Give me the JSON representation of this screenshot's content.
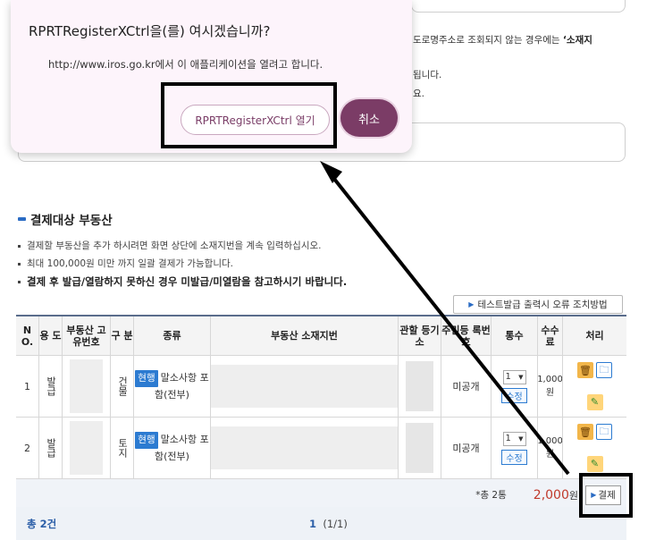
{
  "background": {
    "notice_line1_plain": "도로명주소로 조회되지 않는 경우에는 ",
    "notice_line1_bold": "‘소재지",
    "notice_line2": "됩니다.",
    "notice_line3": "요."
  },
  "section": {
    "title": "결제대상 부동산",
    "notes": [
      "결제할 부동산을 추가 하시려면 화면 상단에 소재지번을 계속 입력하십시오.",
      "최대 100,000원 미만 까지 일괄 결제가 가능합니다.",
      "결제 후 발급/열람하지 못하신 경우 미발급/미열람을 참고하시기 바랍니다."
    ],
    "guide_button": "테스트발급 출력시 오류 조치방법"
  },
  "table": {
    "headers": [
      "N O.",
      "용 도",
      "부동산 고유번호",
      "구 분",
      "종류",
      "부동산 소재지번",
      "관할 등기소",
      "주민등 록번호",
      "통수",
      "수수 료",
      "처리"
    ],
    "rows": [
      {
        "no": "1",
        "use": "발급",
        "category": "건물",
        "type_tag": "현행",
        "type_text": "말소사항 포함(전부)",
        "resident": "미공개",
        "count": "1",
        "edit": "수정",
        "fee": "1,000원"
      },
      {
        "no": "2",
        "use": "발급",
        "category": "토지",
        "type_tag": "현행",
        "type_text": "말소사항 포함(전부)",
        "resident": "미공개",
        "count": "1",
        "edit": "수정",
        "fee": "1,000원"
      }
    ],
    "summary_text": "*총 2통",
    "summary_amount": "2,000",
    "summary_unit": "원",
    "pay_button": "결제"
  },
  "footer": {
    "total": "총 2건",
    "page_current": "1",
    "page_info": "(1/1)"
  },
  "dialog": {
    "title": "RPRTRegisterXCtrl을(를) 여시겠습니까?",
    "message": "http://www.iros.go.kr에서 이 애플리케이션을 열려고 합니다.",
    "open_button": "RPRTRegisterXCtrl 열기",
    "cancel_button": "취소"
  },
  "colors": {
    "dialog_bg": "#fdf4fb",
    "cancel_button": "#7b3c66",
    "accent_blue": "#2c7bd1",
    "amount_red": "#c0392b"
  }
}
